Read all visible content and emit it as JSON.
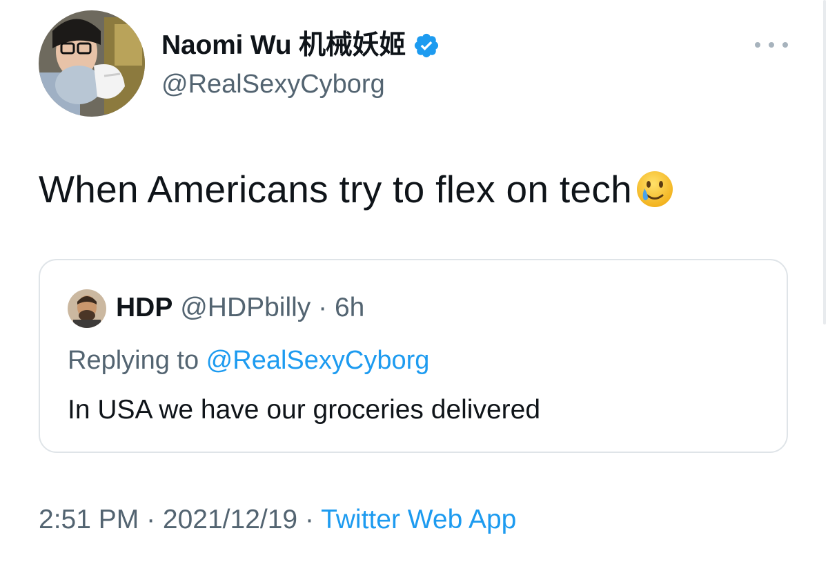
{
  "author": {
    "name": "Naomi Wu 机械妖姬",
    "handle": "@RealSexyCyborg",
    "verified": true
  },
  "tweet": {
    "text": "When Americans try to flex on tech",
    "emoji": "smiling-face-with-tear"
  },
  "quoted_tweet": {
    "name": "HDP",
    "handle": "@HDPbilly",
    "separator": " · ",
    "time": "6h",
    "replying_prefix": "Replying to ",
    "replying_to": "@RealSexyCyborg",
    "text": "In USA we have our groceries delivered"
  },
  "meta": {
    "time": "2:51 PM",
    "separator1": " · ",
    "date": "2021/12/19",
    "separator2": " · ",
    "source": "Twitter Web App"
  },
  "colors": {
    "text_primary": "#0f1419",
    "text_secondary": "#536471",
    "accent": "#1d9bf0",
    "border": "#dfe4e8"
  },
  "icons": {
    "verified": "verified-badge-icon",
    "more": "more-options-icon",
    "emoji": "smiling-face-with-tear-emoji"
  }
}
